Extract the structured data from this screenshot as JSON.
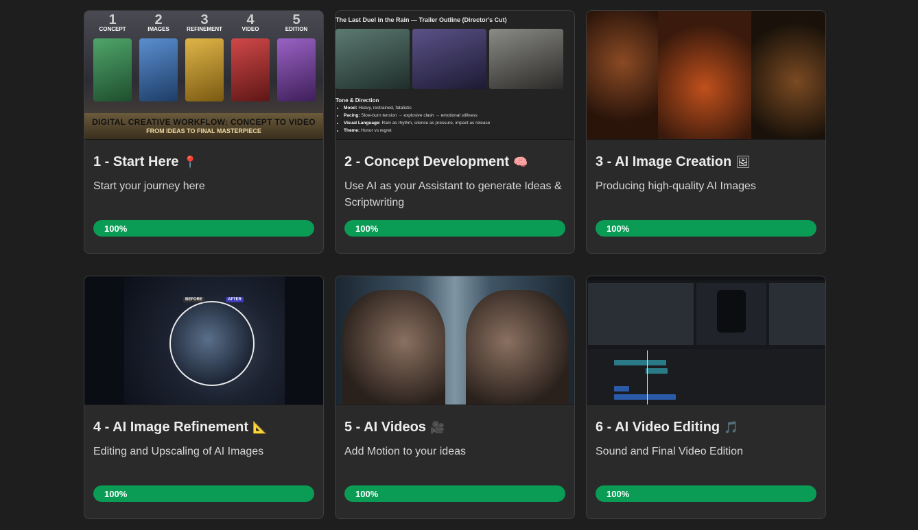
{
  "cards": [
    {
      "title": "1 - Start Here",
      "emoji": "📍",
      "description": "Start your journey here",
      "progress": 100,
      "progress_label": "100%",
      "thumbnail": {
        "steps": [
          {
            "num": "1",
            "label": "CONCEPT",
            "color": "#2f7a48"
          },
          {
            "num": "2",
            "label": "IMAGES",
            "color": "#2e5a8f"
          },
          {
            "num": "3",
            "label": "REFINEMENT",
            "color": "#b08a2a"
          },
          {
            "num": "4",
            "label": "VIDEO",
            "color": "#9a2a2a"
          },
          {
            "num": "5",
            "label": "EDITION",
            "color": "#6a3a8a"
          }
        ],
        "banner_title": "DIGITAL CREATIVE WORKFLOW: CONCEPT TO VIDEO",
        "banner_subtitle": "FROM IDEAS TO FINAL MASTERPIECE"
      }
    },
    {
      "title": "2 - Concept Development",
      "emoji": "🧠",
      "description": "Use AI as your Assistant to generate Ideas & Scriptwriting",
      "progress": 100,
      "progress_label": "100%",
      "thumbnail": {
        "doc_title": "The Last Duel in the Rain — Trailer Outline (Director's Cut)",
        "section": "Tone & Direction",
        "bullets": [
          {
            "key": "Mood:",
            "text": "Heavy, restrained, fatalistic"
          },
          {
            "key": "Pacing:",
            "text": "Slow-burn tension → explosive clash → emotional stillness"
          },
          {
            "key": "Visual Language:",
            "text": "Rain as rhythm, silence as pressure, impact as release"
          },
          {
            "key": "Theme:",
            "text": "Honor vs regret"
          }
        ]
      }
    },
    {
      "title": "3 - AI Image Creation",
      "emoji": "🖼",
      "description": "Producing high-quality AI Images",
      "progress": 100,
      "progress_label": "100%"
    },
    {
      "title": "4 - AI Image Refinement",
      "emoji": "📐",
      "description": "Editing and Upscaling of AI Images",
      "progress": 100,
      "progress_label": "100%",
      "thumbnail": {
        "before_label": "BEFORE",
        "after_label": "AFTER"
      }
    },
    {
      "title": "5 - AI Videos",
      "emoji": "🎥",
      "description": "Add Motion to your ideas",
      "progress": 100,
      "progress_label": "100%"
    },
    {
      "title": "6 - AI Video Editing",
      "emoji": "🎵",
      "description": "Sound and Final Video Edition",
      "progress": 100,
      "progress_label": "100%"
    }
  ],
  "colors": {
    "background": "#1e1e1e",
    "card": "#2a2a2a",
    "progress_fill": "#0a9c55"
  }
}
